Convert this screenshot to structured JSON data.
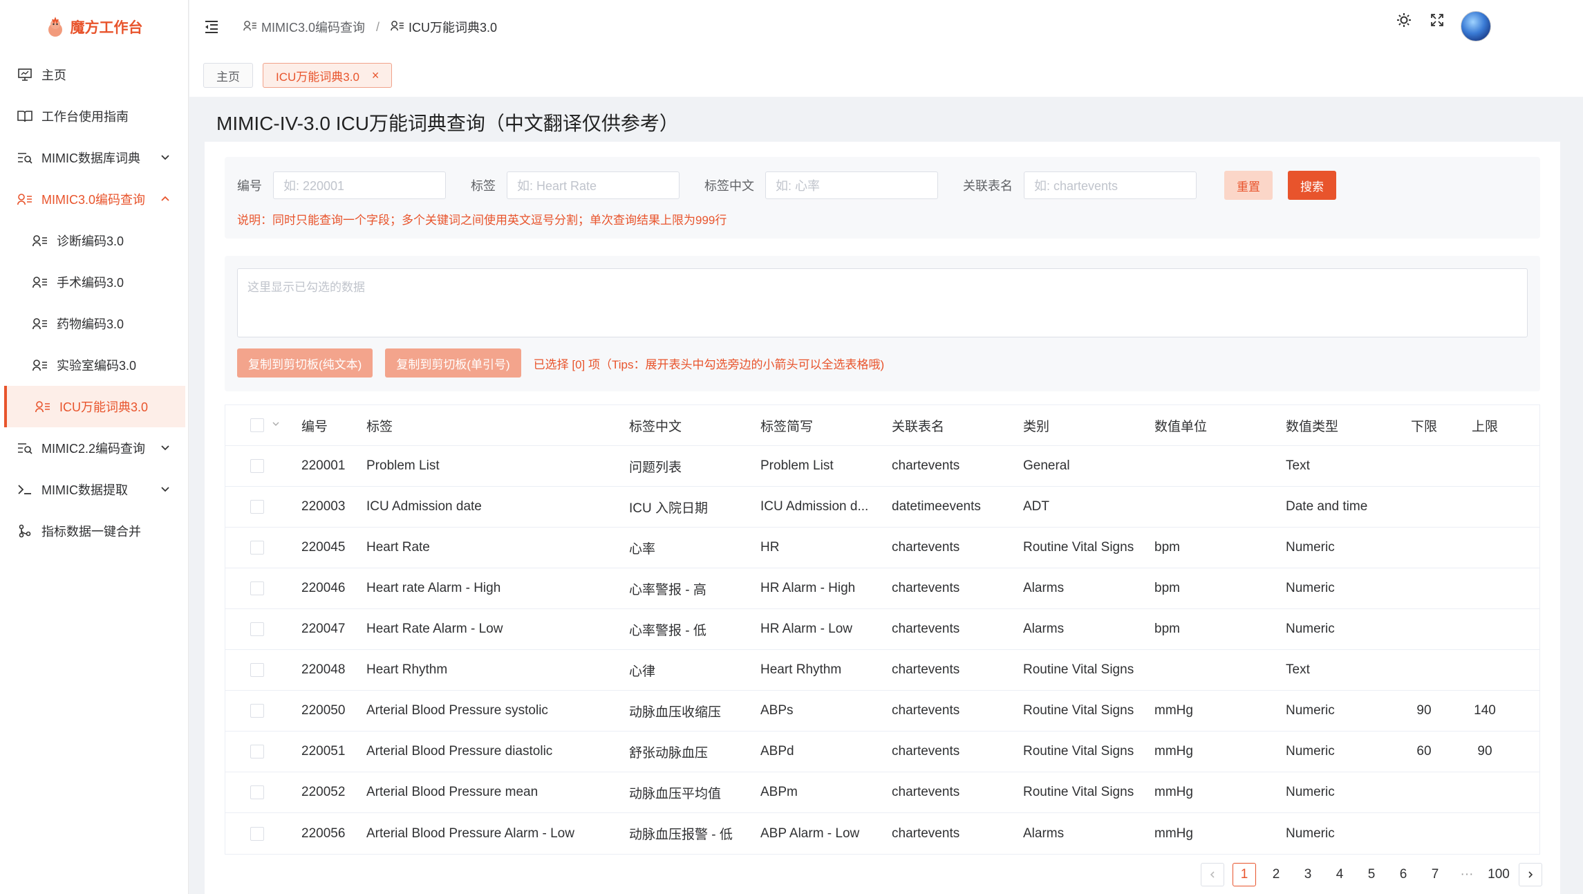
{
  "app": {
    "title": "魔方工作台"
  },
  "sidebar": {
    "items": [
      {
        "label": "主页",
        "icon": "monitor-icon"
      },
      {
        "label": "工作台使用指南",
        "icon": "book-icon"
      },
      {
        "label": "MIMIC数据库词典",
        "icon": "search-list-icon"
      },
      {
        "label": "MIMIC3.0编码查询",
        "icon": "user-list-icon"
      },
      {
        "label": "诊断编码3.0",
        "icon": "user-list-icon"
      },
      {
        "label": "手术编码3.0",
        "icon": "user-list-icon"
      },
      {
        "label": "药物编码3.0",
        "icon": "user-list-icon"
      },
      {
        "label": "实验室编码3.0",
        "icon": "user-list-icon"
      },
      {
        "label": "ICU万能词典3.0",
        "icon": "user-list-icon"
      },
      {
        "label": "MIMIC2.2编码查询",
        "icon": "search-list-icon"
      },
      {
        "label": "MIMIC数据提取",
        "icon": "terminal-icon"
      },
      {
        "label": "指标数据一键合并",
        "icon": "branch-icon"
      }
    ]
  },
  "header": {
    "breadcrumb": [
      "MIMIC3.0编码查询",
      "ICU万能词典3.0"
    ],
    "separator": "/"
  },
  "tabs": [
    {
      "label": "主页"
    },
    {
      "label": "ICU万能词典3.0",
      "close": "×"
    }
  ],
  "page": {
    "title": "MIMIC-IV-3.0 ICU万能词典查询（中文翻译仅供参考）"
  },
  "filters": {
    "id_label": "编号",
    "id_placeholder": "如:  220001",
    "label_label": "标签",
    "label_placeholder": "如: Heart Rate",
    "cn_label": "标签中文",
    "cn_placeholder": "如: 心率",
    "table_label": "关联表名",
    "table_placeholder": "如: chartevents",
    "reset": "重置",
    "search": "搜索",
    "note": "说明：同时只能查询一个字段；多个关键词之间使用英文逗号分割；单次查询结果上限为999行"
  },
  "selection": {
    "placeholder": "这里显示已勾选的数据",
    "copy_plain": "复制到剪切板(纯文本)",
    "copy_quote": "复制到剪切板(单引号)",
    "tip": "已选择 [0] 项（Tips：展开表头中勾选旁边的小箭头可以全选表格哦)"
  },
  "table": {
    "headers": [
      "编号",
      "标签",
      "标签中文",
      "标签简写",
      "关联表名",
      "类别",
      "数值单位",
      "数值类型",
      "下限",
      "上限"
    ],
    "rows": [
      [
        "220001",
        "Problem List",
        "问题列表",
        "Problem List",
        "chartevents",
        "General",
        "",
        "Text",
        "",
        ""
      ],
      [
        "220003",
        "ICU Admission date",
        "ICU 入院日期",
        "ICU Admission d...",
        "datetimeevents",
        "ADT",
        "",
        "Date and time",
        "",
        ""
      ],
      [
        "220045",
        "Heart Rate",
        "心率",
        "HR",
        "chartevents",
        "Routine Vital Signs",
        "bpm",
        "Numeric",
        "",
        ""
      ],
      [
        "220046",
        "Heart rate Alarm - High",
        "心率警报 - 高",
        "HR Alarm - High",
        "chartevents",
        "Alarms",
        "bpm",
        "Numeric",
        "",
        ""
      ],
      [
        "220047",
        "Heart Rate Alarm - Low",
        "心率警报 - 低",
        "HR Alarm - Low",
        "chartevents",
        "Alarms",
        "bpm",
        "Numeric",
        "",
        ""
      ],
      [
        "220048",
        "Heart Rhythm",
        "心律",
        "Heart Rhythm",
        "chartevents",
        "Routine Vital Signs",
        "",
        "Text",
        "",
        ""
      ],
      [
        "220050",
        "Arterial Blood Pressure systolic",
        "动脉血压收缩压",
        "ABPs",
        "chartevents",
        "Routine Vital Signs",
        "mmHg",
        "Numeric",
        "90",
        "140"
      ],
      [
        "220051",
        "Arterial Blood Pressure diastolic",
        "舒张动脉血压",
        "ABPd",
        "chartevents",
        "Routine Vital Signs",
        "mmHg",
        "Numeric",
        "60",
        "90"
      ],
      [
        "220052",
        "Arterial Blood Pressure mean",
        "动脉血压平均值",
        "ABPm",
        "chartevents",
        "Routine Vital Signs",
        "mmHg",
        "Numeric",
        "",
        ""
      ],
      [
        "220056",
        "Arterial Blood Pressure Alarm - Low",
        "动脉血压报警 - 低",
        "ABP Alarm - Low",
        "chartevents",
        "Alarms",
        "mmHg",
        "Numeric",
        "",
        ""
      ]
    ]
  },
  "pagination": {
    "pages": [
      "1",
      "2",
      "3",
      "4",
      "5",
      "6",
      "7"
    ],
    "ellipsis": "···",
    "last": "100",
    "current": "1"
  },
  "colors": {
    "accent": "#e8542c",
    "accent_light": "#fdeee8"
  }
}
